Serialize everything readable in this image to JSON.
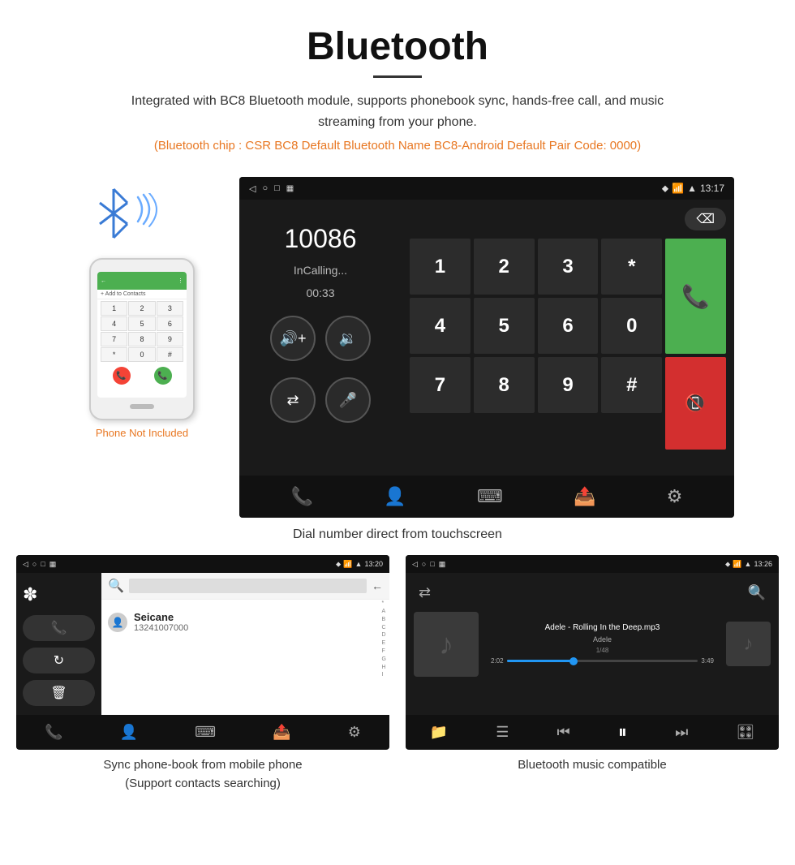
{
  "header": {
    "title": "Bluetooth",
    "description": "Integrated with BC8 Bluetooth module, supports phonebook sync, hands-free call, and music streaming from your phone.",
    "highlight": "(Bluetooth chip : CSR BC8    Default Bluetooth Name BC8-Android    Default Pair Code: 0000)"
  },
  "dial_screen": {
    "status_bar": {
      "time": "13:17",
      "icons": "♦ ☎ ▼"
    },
    "number": "10086",
    "call_status": "InCalling...",
    "timer": "00:33",
    "numpad": [
      "1",
      "2",
      "3",
      "*",
      "4",
      "5",
      "6",
      "0",
      "7",
      "8",
      "9",
      "#"
    ],
    "backspace": "⌫"
  },
  "dial_caption": "Dial number direct from touchscreen",
  "phonebook_screen": {
    "status_bar": {
      "time": "13:20"
    },
    "contact_name": "Seicane",
    "contact_phone": "13241007000",
    "alphabet": [
      "*",
      "A",
      "B",
      "C",
      "D",
      "E",
      "F",
      "G",
      "H",
      "I"
    ]
  },
  "phonebook_caption_line1": "Sync phone-book from mobile phone",
  "phonebook_caption_line2": "(Support contacts searching)",
  "music_screen": {
    "status_bar": {
      "time": "13:26"
    },
    "song_title": "Adele - Rolling In the Deep.mp3",
    "artist": "Adele",
    "track_count": "1/48",
    "time_current": "2:02",
    "time_total": "3:49",
    "progress_percent": 35
  },
  "music_caption": "Bluetooth music compatible",
  "phone_label": "Phone Not Included",
  "status_bar_items": {
    "back": "◁",
    "home": "○",
    "square": "□"
  }
}
